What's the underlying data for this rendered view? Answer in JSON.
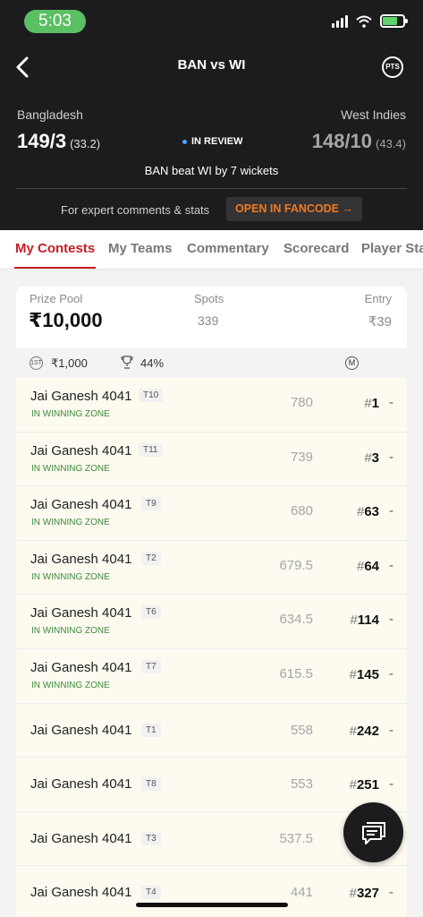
{
  "status_bar": {
    "time": "5:03"
  },
  "header": {
    "title": "BAN vs WI",
    "pts_label": "PTS",
    "team_left": "Bangladesh",
    "team_right": "West Indies",
    "score_left": "149/3",
    "overs_left": "(33.2)",
    "score_right": "148/10",
    "overs_right": "(43.4)",
    "status": "IN REVIEW",
    "result": "BAN beat WI by 7 wickets",
    "expert_text": "For expert comments & stats",
    "fancode_label": "OPEN IN FANCODE →"
  },
  "tabs": [
    "My Contests",
    "My Teams",
    "Commentary",
    "Scorecard",
    "Player Sta"
  ],
  "contest": {
    "prize_pool_label": "Prize Pool",
    "prize_pool": "₹10,000",
    "spots_label": "Spots",
    "spots": "339",
    "entry_label": "Entry",
    "entry": "₹39",
    "first_badge": "1ST",
    "first_prize": "₹1,000",
    "win_percent": "44%",
    "m_badge": "M"
  },
  "rows": [
    {
      "name": "Jai Ganesh 4041",
      "team": "T10",
      "zone": "IN WINNING ZONE",
      "points": "780",
      "rank": "1"
    },
    {
      "name": "Jai Ganesh 4041",
      "team": "T11",
      "zone": "IN WINNING ZONE",
      "points": "739",
      "rank": "3"
    },
    {
      "name": "Jai Ganesh 4041",
      "team": "T9",
      "zone": "IN WINNING ZONE",
      "points": "680",
      "rank": "63"
    },
    {
      "name": "Jai Ganesh 4041",
      "team": "T2",
      "zone": "IN WINNING ZONE",
      "points": "679.5",
      "rank": "64"
    },
    {
      "name": "Jai Ganesh 4041",
      "team": "T6",
      "zone": "IN WINNING ZONE",
      "points": "634.5",
      "rank": "114"
    },
    {
      "name": "Jai Ganesh 4041",
      "team": "T7",
      "zone": "IN WINNING ZONE",
      "points": "615.5",
      "rank": "145"
    },
    {
      "name": "Jai Ganesh 4041",
      "team": "T1",
      "zone": "",
      "points": "558",
      "rank": "242"
    },
    {
      "name": "Jai Ganesh 4041",
      "team": "T8",
      "zone": "",
      "points": "553",
      "rank": "251"
    },
    {
      "name": "Jai Ganesh 4041",
      "team": "T3",
      "zone": "",
      "points": "537.5",
      "rank": ""
    },
    {
      "name": "Jai Ganesh 4041",
      "team": "T4",
      "zone": "",
      "points": "441",
      "rank": "327"
    }
  ],
  "colors": {
    "header_bg": "#1c1c1e",
    "accent_red": "#c81d25",
    "fancode_orange": "#f0791f",
    "winning_green": "#3b8a3b",
    "row_bg": "#fdfaf0"
  },
  "icons": {
    "back": "chevron-left-icon",
    "pts": "pts-icon",
    "trophy": "trophy-icon",
    "chat": "chat-icon"
  }
}
